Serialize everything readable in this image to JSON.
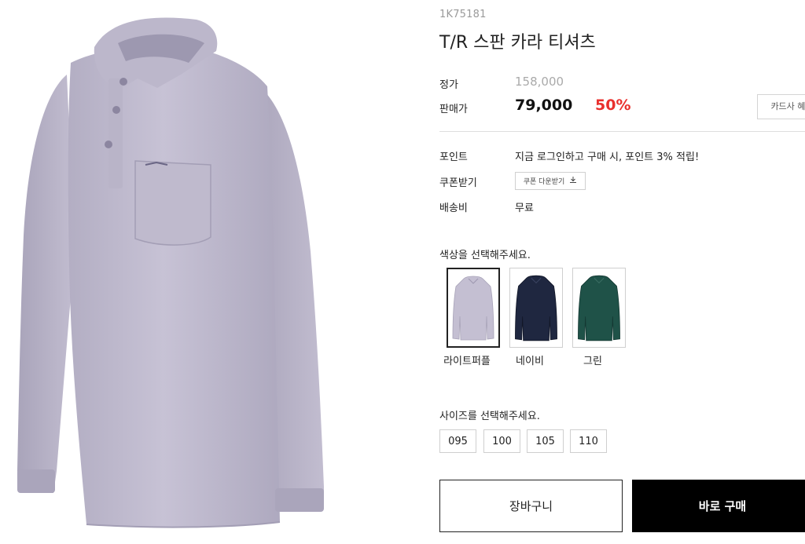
{
  "product": {
    "code": "1K75181",
    "title": "T/R 스판 카라 티셔츠",
    "image_alt": "라이트퍼플 카라 티셔츠"
  },
  "price": {
    "list_label": "정가",
    "list_value": "158,000",
    "sale_label": "판매가",
    "sale_value": "79,000",
    "discount": "50%",
    "card_benefit_label": "카드사 혜택"
  },
  "info": {
    "points_label": "포인트",
    "points_text": "지금 로그인하고 구매 시, 포인트 3% 적립!",
    "coupon_label": "쿠폰받기",
    "coupon_button": "쿠폰 다운받기",
    "shipping_label": "배송비",
    "shipping_value": "무료"
  },
  "colors": {
    "prompt": "색상을 선택해주세요.",
    "options": [
      {
        "name": "라이트퍼플",
        "hex": "#c4bfd2",
        "selected": true
      },
      {
        "name": "네이비",
        "hex": "#1f2740",
        "selected": false
      },
      {
        "name": "그린",
        "hex": "#1f5248",
        "selected": false
      }
    ]
  },
  "sizes": {
    "prompt": "사이즈를 선택해주세요.",
    "options": [
      "095",
      "100",
      "105",
      "110"
    ]
  },
  "actions": {
    "cart_label": "장바구니",
    "buy_label": "바로 구매"
  },
  "theme": {
    "discount_color": "#e9302d",
    "buy_button_bg": "#000000"
  }
}
